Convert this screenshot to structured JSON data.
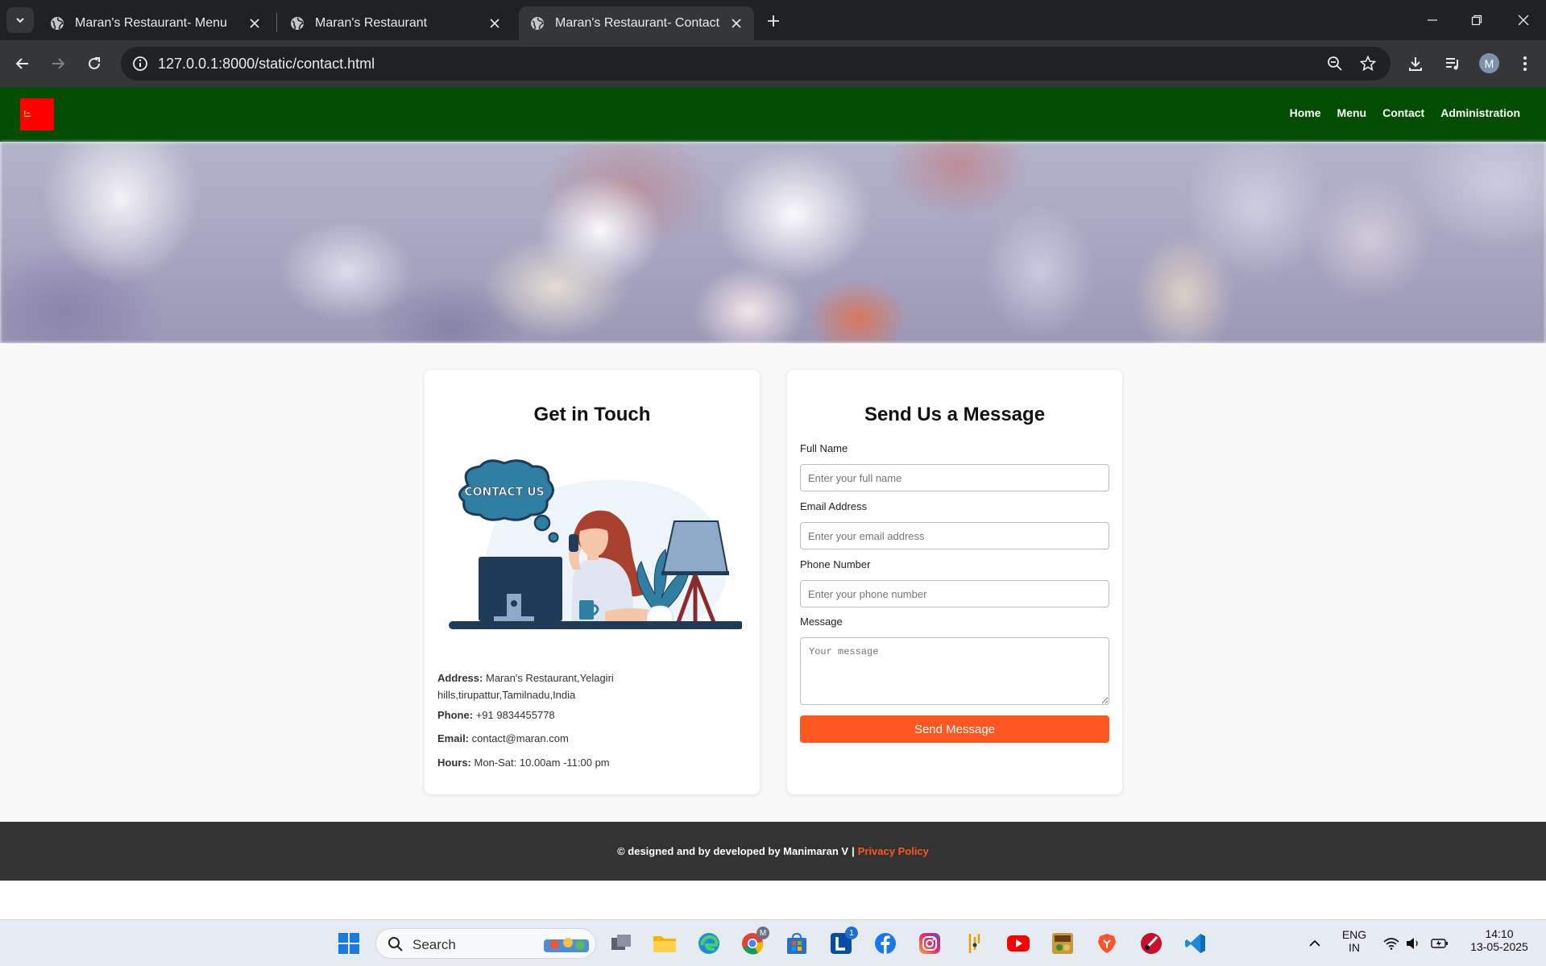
{
  "browser": {
    "tabs": [
      {
        "title": "Maran's Restaurant- Menu",
        "active": false
      },
      {
        "title": "Maran's Restaurant",
        "active": false
      },
      {
        "title": "Maran's Restaurant- Contact Us",
        "active": true
      }
    ],
    "url": "127.0.0.1:8000/static/contact.html",
    "profile_initial": "M"
  },
  "site": {
    "nav": [
      "Home",
      "Menu",
      "Contact",
      "Administration"
    ],
    "colors": {
      "header": "#034d03",
      "accent": "#ff5722",
      "footer": "#333333",
      "logo": "#ff0000"
    }
  },
  "contact": {
    "title": "Get in Touch",
    "illustration_bubble": "CONTACT US",
    "address_label": "Address:",
    "address_value": "Maran's Restaurant,Yelagiri hills,tirupattur,Tamilnadu,India",
    "phone_label": "Phone:",
    "phone_value": "+91 9834455778",
    "email_label": "Email:",
    "email_value": "contact@maran.com",
    "hours_label": "Hours:",
    "hours_value": "Mon-Sat: 10.00am -11:00 pm"
  },
  "form": {
    "title": "Send Us a Message",
    "fullname_label": "Full Name",
    "fullname_placeholder": "Enter your full name",
    "email_label": "Email Address",
    "email_placeholder": "Enter your email address",
    "phone_label": "Phone Number",
    "phone_placeholder": "Enter your phone number",
    "message_label": "Message",
    "message_placeholder": "Your message",
    "submit_label": "Send Message"
  },
  "footer": {
    "credit": "© designed and by developed by Manimaran V",
    "separator": "|",
    "privacy": "Privacy Policy"
  },
  "taskbar": {
    "search_label": "Search",
    "lang_line1": "ENG",
    "lang_line2": "IN",
    "time": "14:10",
    "date": "13-05-2025",
    "notification_badge": "1",
    "chrome_badge": "M"
  }
}
